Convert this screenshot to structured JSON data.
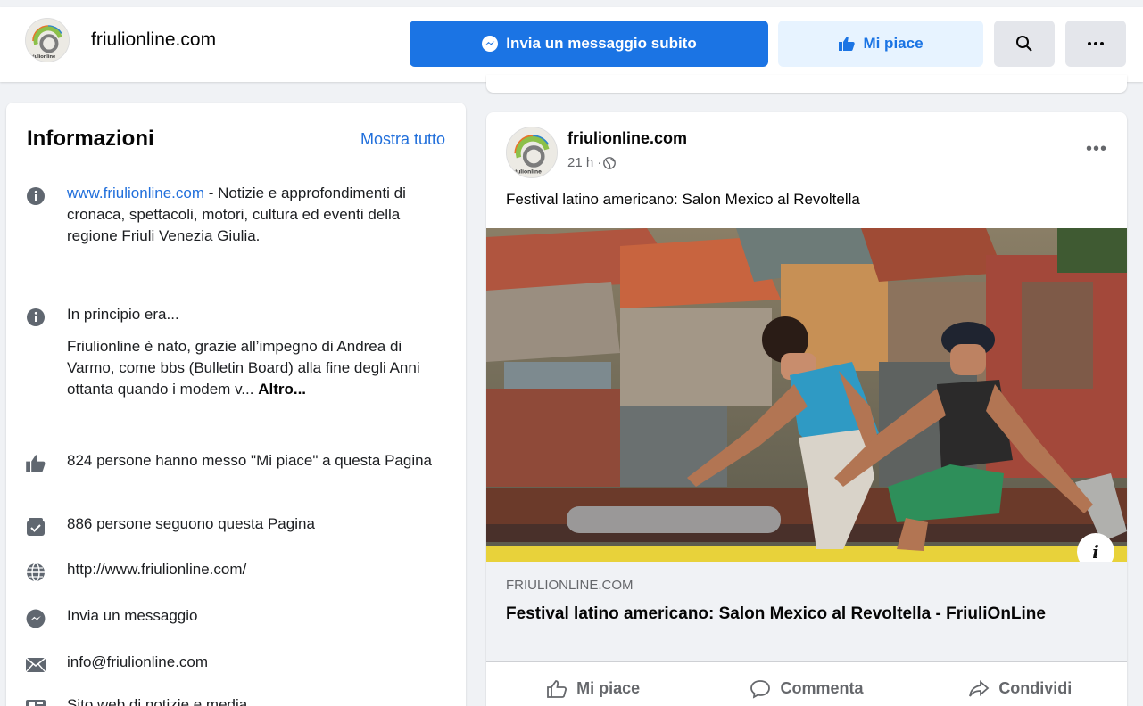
{
  "header": {
    "page_name": "friulionline.com",
    "logo_text": "friulionline",
    "message_button": "Invia un messaggio subito",
    "like_button": "Mi piace"
  },
  "info": {
    "title": "Informazioni",
    "show_all": "Mostra tutto",
    "website_link": "www.friulionline.com",
    "description": " - Notizie e approfondimenti di cronaca, spettacoli, motori, cultura ed eventi della regione Friuli Venezia Giulia.",
    "history_title": "In principio era...",
    "history_text": "Friulionline è nato, grazie all’impegno di Andrea di Varmo, come bbs (Bulletin Board) alla fine degli Anni ottanta quando i modem v... ",
    "history_more": "Altro...",
    "likes": "824 persone hanno messo \"Mi piace\" a questa Pagina",
    "followers": "886 persone seguono questa Pagina",
    "url": "http://www.friulionline.com/",
    "send_message": "Invia un messaggio",
    "email": "info@friulionline.com",
    "category": "Sito web di notizie e media"
  },
  "post": {
    "author": "friulionline.com",
    "time": "21 h · ",
    "text": "Festival latino americano: Salon Mexico al Revoltella",
    "image_info": "i",
    "link_domain": "FRIULIONLINE.COM",
    "link_title": "Festival latino americano: Salon Mexico al Revoltella - FriuliOnLine",
    "actions": {
      "like": "Mi piace",
      "comment": "Commenta",
      "share": "Condividi"
    }
  },
  "colors": {
    "accent": "#1b74e4",
    "link": "#216fdb",
    "background": "#f0f2f5"
  }
}
